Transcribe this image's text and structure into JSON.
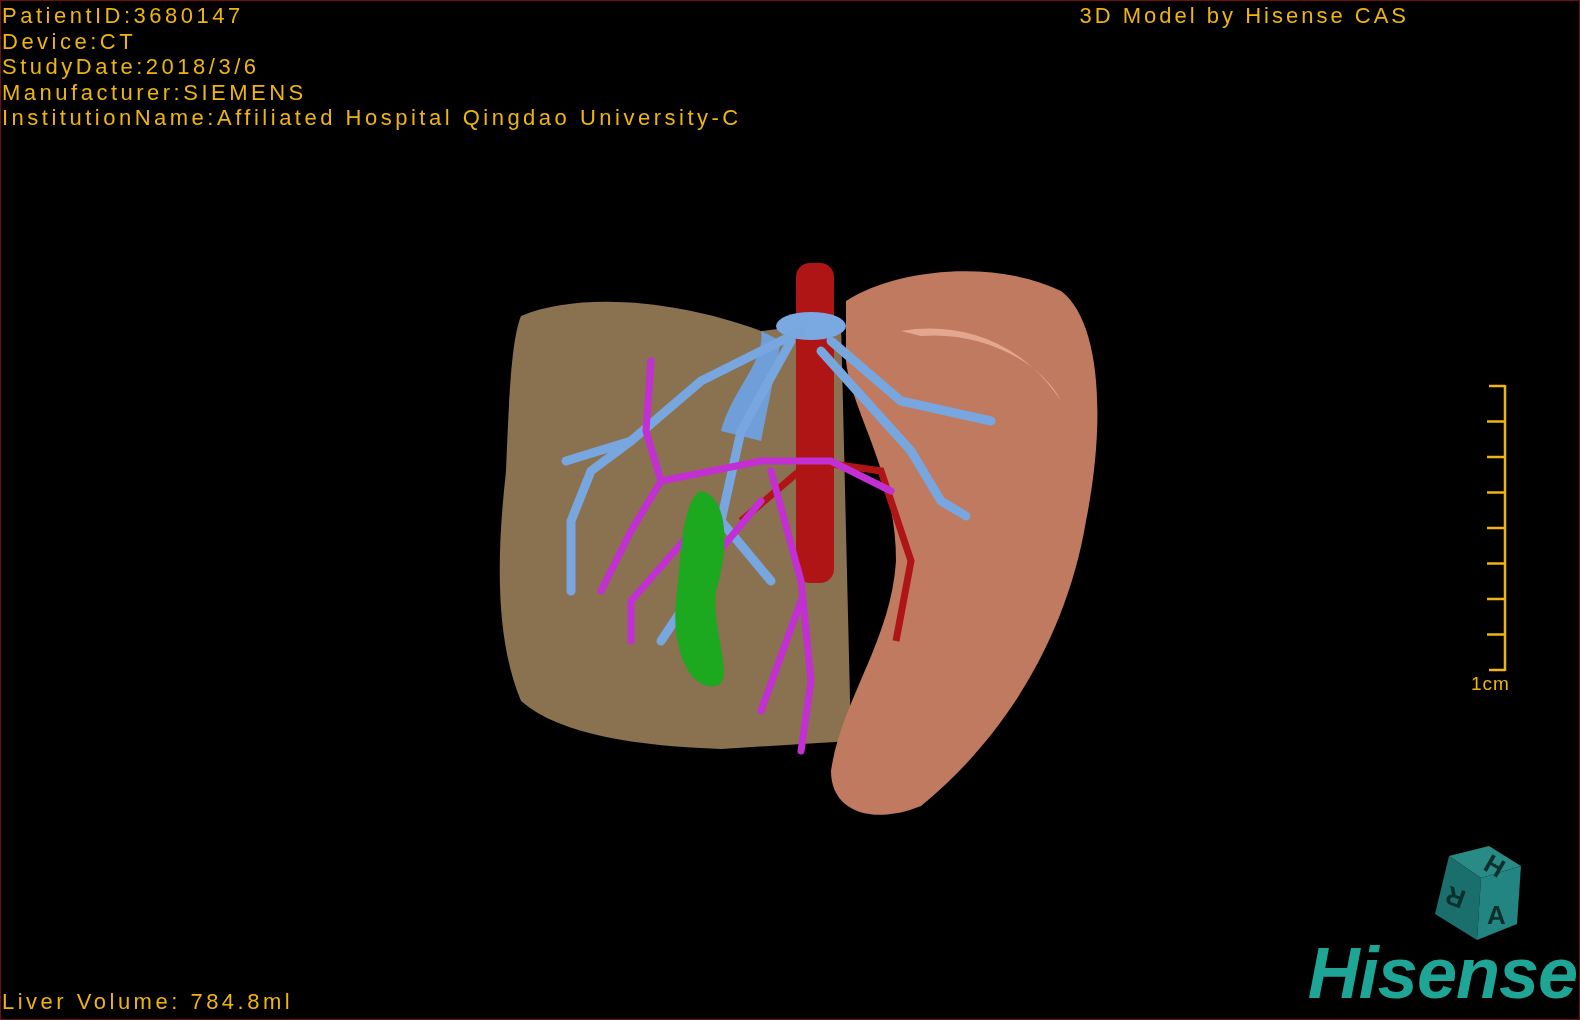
{
  "header_info": [
    "PatientID:3680147",
    "Device:CT",
    "StudyDate:2018/3/6",
    "Manufacturer:SIEMENS",
    "InstitutionName:Affiliated Hospital Qingdao University-C"
  ],
  "model_title": "3D Model by Hisense CAS",
  "scale_bar": {
    "label": "1cm"
  },
  "orientation_cube": {
    "labels": [
      "H",
      "R",
      "A"
    ]
  },
  "logo": "Hisense",
  "liver_volume": "Liver Volume: 784.8ml"
}
